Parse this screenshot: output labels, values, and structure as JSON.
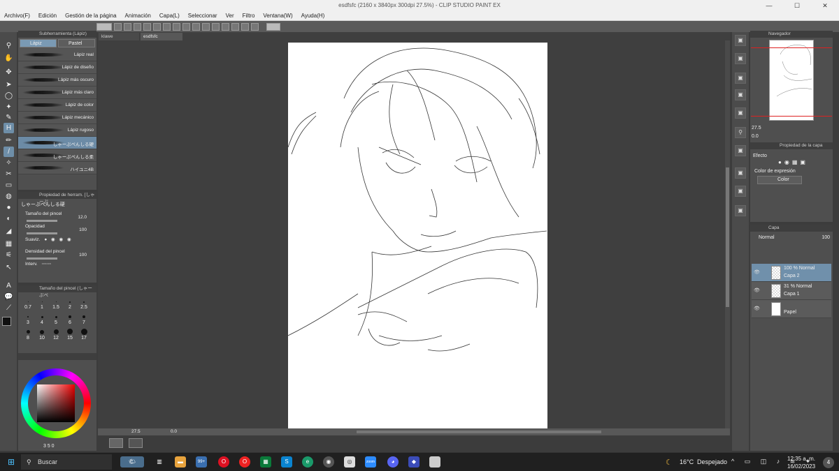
{
  "window": {
    "title": "esdfsfc (2160 x 3840px 300dpi 27.5%) - CLIP STUDIO PAINT EX"
  },
  "menu": [
    "Archivo(F)",
    "Edición",
    "Gestión de la página",
    "Animación",
    "Capa(L)",
    "Seleccionar",
    "Ver",
    "Filtro",
    "Ventana(W)",
    "Ayuda(H)"
  ],
  "doc_tabs": [
    "klawe",
    "esdfsfc"
  ],
  "subtool": {
    "header": "Subherramienta (Lápiz)",
    "tabs": [
      "Lápiz",
      "Pastel"
    ],
    "brushes": [
      "Lápiz real",
      "Lápiz de diseño",
      "Lápiz más oscuro",
      "Lápiz más claro",
      "Lápiz de color",
      "Lápiz mecánico",
      "Lápiz rugoso",
      "しゃーぷぺんしる硬",
      "しゃーぷぺんしる柔",
      "ハイユニ4B"
    ]
  },
  "tool_property": {
    "header": "Propiedad de herram. [しゃーぷ",
    "brush_name": "しゃーぷぺんしる硬",
    "size_label": "Tamaño del pincel",
    "size_value": "12.0",
    "opacity_label": "Opacidad",
    "opacity_value": "100",
    "smooth_label": "Suaviz.",
    "density_label": "Densidad del pincel",
    "density_value": "100",
    "interval_label": "Interv."
  },
  "brush_size": {
    "header": "Tamaño del pincel (しゃーぷぺ",
    "sizes": [
      "0.7",
      "1",
      "1.5",
      "2",
      "2.5",
      "3",
      "4",
      "5",
      "6",
      "7",
      "8",
      "10",
      "12",
      "15",
      "17"
    ]
  },
  "color_readout": "3 5 0",
  "status": {
    "zoom": "27.5",
    "angle": "0.0"
  },
  "navigator": {
    "header": "Navegador",
    "zoom": "27.5",
    "angle": "0.0"
  },
  "effect": {
    "header": "Propiedad de la capa",
    "effect_label": "Efecto",
    "expr_label": "Color de expresión",
    "expr_value": "Color"
  },
  "layers": {
    "header": "Capa",
    "blend": "Normal",
    "opacity": "100",
    "items": [
      {
        "line1": "100 % Normal",
        "line2": "Capa 2"
      },
      {
        "line1": "31 % Normal",
        "line2": "Capa 1"
      },
      {
        "line1": "",
        "line2": "Papel"
      }
    ]
  },
  "taskbar": {
    "search": "Buscar",
    "badge": "99+",
    "weather_temp": "16°C",
    "weather_desc": "Despejado",
    "time": "12:35 a. m.",
    "date": "16/02/2023",
    "notif": "4"
  }
}
